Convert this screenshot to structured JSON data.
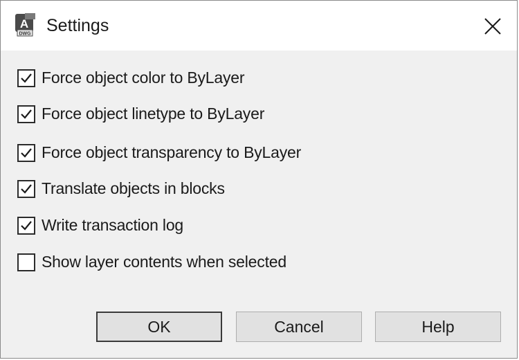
{
  "window": {
    "title": "Settings",
    "app_icon": "autocad-dwg-icon",
    "app_icon_letter": "A",
    "app_icon_tag": "DWG",
    "close_icon": "close-icon"
  },
  "options": [
    {
      "label": "Force object color to ByLayer",
      "checked": true
    },
    {
      "label": "Force object linetype to ByLayer",
      "checked": true
    },
    {
      "label": "Force object transparency to ByLayer",
      "checked": true
    },
    {
      "label": "Translate objects in blocks",
      "checked": true
    },
    {
      "label": "Write transaction log",
      "checked": true
    },
    {
      "label": "Show layer contents when selected",
      "checked": false
    }
  ],
  "buttons": {
    "ok": "OK",
    "cancel": "Cancel",
    "help": "Help"
  },
  "colors": {
    "dialog_background": "#f0f0f0",
    "titlebar_background": "#ffffff",
    "button_background": "#e1e1e1"
  }
}
